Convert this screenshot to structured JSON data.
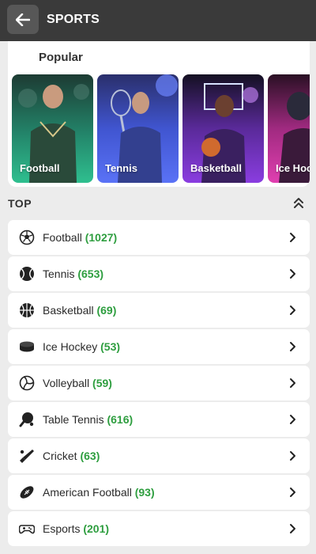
{
  "header": {
    "title": "SPORTS"
  },
  "popular": {
    "title": "Popular",
    "tiles": [
      {
        "label": "Football",
        "from": "#2fbf8f",
        "to": "#138062"
      },
      {
        "label": "Tennis",
        "from": "#4f6ff5",
        "to": "#3b4fd9"
      },
      {
        "label": "Basketball",
        "from": "#8a3de0",
        "to": "#6a2bb8"
      },
      {
        "label": "Ice Hockey",
        "from": "#e03fb0",
        "to": "#b82b8f"
      }
    ]
  },
  "top": {
    "label": "TOP",
    "items": [
      {
        "name": "Football",
        "count": "(1027)",
        "icon": "soccer-ball-icon"
      },
      {
        "name": "Tennis",
        "count": "(653)",
        "icon": "tennis-ball-icon"
      },
      {
        "name": "Basketball",
        "count": "(69)",
        "icon": "basketball-icon"
      },
      {
        "name": "Ice Hockey",
        "count": "(53)",
        "icon": "hockey-puck-icon"
      },
      {
        "name": "Volleyball",
        "count": "(59)",
        "icon": "volleyball-icon"
      },
      {
        "name": "Table Tennis",
        "count": "(616)",
        "icon": "ping-pong-icon"
      },
      {
        "name": "Cricket",
        "count": "(63)",
        "icon": "cricket-bat-icon"
      },
      {
        "name": "American Football",
        "count": "(93)",
        "icon": "american-football-icon"
      },
      {
        "name": "Esports",
        "count": "(201)",
        "icon": "gamepad-icon"
      }
    ]
  },
  "colors": {
    "header_bg": "#3a3a3a",
    "count_green": "#2e9e3f",
    "page_bg": "#ececec"
  }
}
